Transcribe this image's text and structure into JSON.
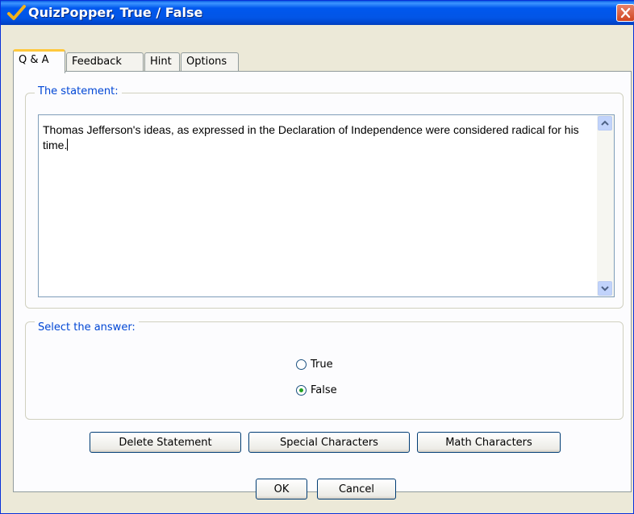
{
  "window": {
    "title": "QuizPopper, True / False"
  },
  "tabs": [
    {
      "label": "Q & A",
      "active": true
    },
    {
      "label": "Feedback",
      "active": false
    },
    {
      "label": "Hint",
      "active": false
    },
    {
      "label": "Options",
      "active": false
    }
  ],
  "statement": {
    "group_label": "The statement:",
    "text": "Thomas Jefferson's ideas, as expressed in the Declaration of Independence were considered radical for his time."
  },
  "answer": {
    "group_label": "Select the answer:",
    "options": [
      {
        "label": "True",
        "selected": false
      },
      {
        "label": "False",
        "selected": true
      }
    ]
  },
  "actions": {
    "delete": "Delete Statement",
    "special": "Special Characters",
    "math": "Math Characters"
  },
  "dialog_buttons": {
    "ok": "OK",
    "cancel": "Cancel"
  },
  "colors": {
    "accent": "#0046d5",
    "title_bar": "#0058ee",
    "active_tab_border": "#ffc83c"
  },
  "icons": {
    "title": "checkmark-icon",
    "close": "close-icon",
    "scroll_up": "arrow-up-icon",
    "scroll_down": "arrow-down-icon"
  }
}
